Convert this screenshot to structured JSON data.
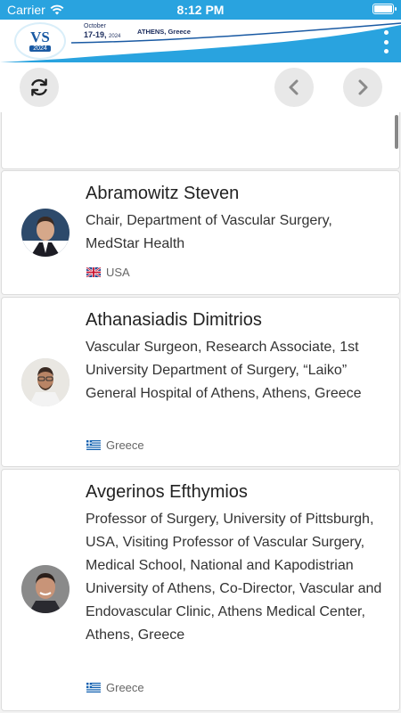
{
  "status_bar": {
    "carrier": "Carrier",
    "time": "8:12 PM"
  },
  "header": {
    "logo_text": "VS",
    "logo_year": "2024",
    "event_month": "October",
    "event_dates": "17-19,",
    "event_year": "2024",
    "event_city": "ATHENS, Greece"
  },
  "toolbar": {
    "refresh_icon": "refresh-icon",
    "prev_icon": "chevron-left-icon",
    "next_icon": "chevron-right-icon"
  },
  "speakers": [
    {
      "name": "Abramowitz Steven",
      "role": "Chair, Department of Vascular Surgery, MedStar Health",
      "country": "USA",
      "flag": "uk-flag-icon"
    },
    {
      "name": "Athanasiadis Dimitrios",
      "role": "Vascular Surgeon, Research Associate, 1st University Department of Surgery, “Laiko” General Hospital of Athens, Athens, Greece",
      "country": "Greece",
      "flag": "greece-flag-icon"
    },
    {
      "name": "Avgerinos Efthymios",
      "role": "Professor of Surgery, University of Pittsburgh, USA, Visiting Professor of Vascular Surgery, Medical School, National and Kapodistrian University of Athens, Co-Director, Vascular and Endovascular Clinic, Athens Medical Center, Athens, Greece",
      "country": "Greece",
      "flag": "greece-flag-icon"
    }
  ]
}
